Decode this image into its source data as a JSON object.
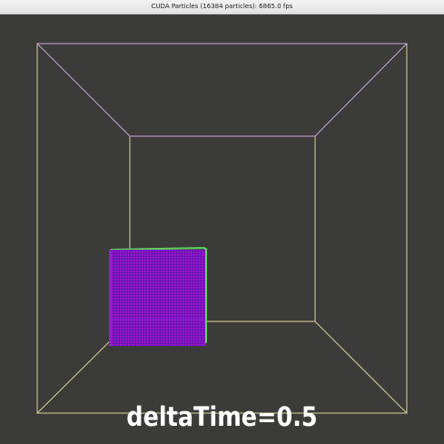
{
  "window": {
    "title": "CUDA Particles (16384 particles): 6865.0 fps"
  },
  "scene": {
    "background_color": "#3b3b39",
    "box_edge_color": "#d8d39a",
    "particle_color": "#7a10c8",
    "particle_highlight_color": "#c020c0",
    "particle_edge_color": "#5fd060"
  },
  "hud": {
    "delta_time_text": "deltaTime=0.5"
  }
}
